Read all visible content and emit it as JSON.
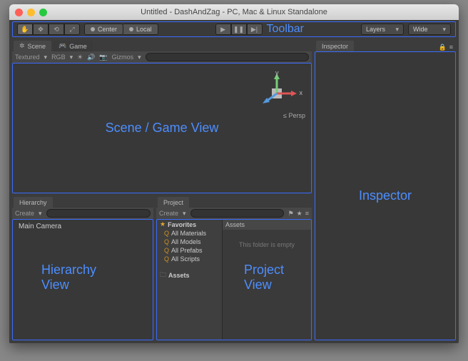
{
  "window": {
    "title": "Untitled - DashAndZag - PC, Mac & Linux Standalone"
  },
  "toolbar": {
    "pivot": "Center",
    "coord": "Local",
    "layers": "Layers",
    "layout": "Wide",
    "annotation": "Toolbar"
  },
  "scene": {
    "tab_scene": "Scene",
    "tab_game": "Game",
    "tools": {
      "shading": "Textured",
      "rgb": "RGB",
      "gizmos": "Gizmos"
    },
    "annotation": "Scene / Game View",
    "axis_x": "x",
    "axis_y": "y",
    "persp": "Persp"
  },
  "hierarchy": {
    "tab": "Hierarchy",
    "create": "Create",
    "items": [
      "Main Camera"
    ],
    "annotation_l1": "Hierarchy",
    "annotation_l2": "View"
  },
  "project": {
    "tab": "Project",
    "create": "Create",
    "favorites_header": "Favorites",
    "favorites": [
      "All Materials",
      "All Models",
      "All Prefabs",
      "All Scripts"
    ],
    "assets_folder": "Assets",
    "assets_header": "Assets",
    "empty": "This folder is empty",
    "annotation_l1": "Project",
    "annotation_l2": "View"
  },
  "inspector": {
    "tab": "Inspector",
    "annotation": "Inspector"
  }
}
